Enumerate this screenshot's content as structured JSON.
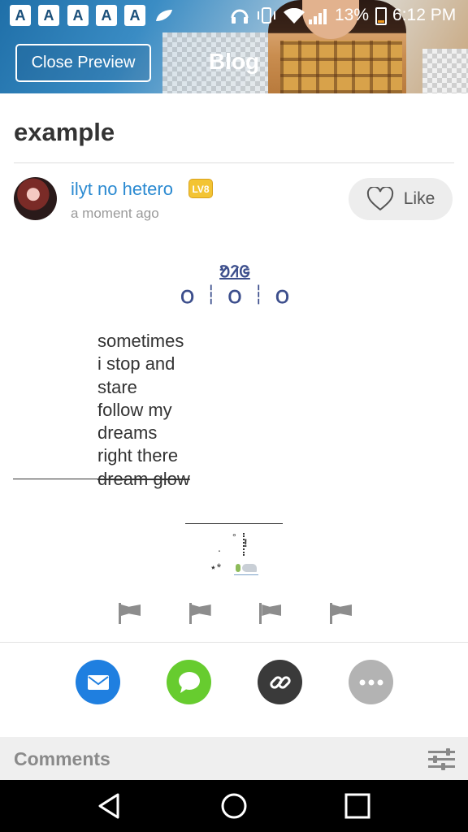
{
  "status_bar": {
    "apps": [
      "A",
      "A",
      "A",
      "A",
      "A"
    ],
    "battery": "13%",
    "time": "6:12 PM"
  },
  "header": {
    "close_label": "Close Preview",
    "title": "Blog"
  },
  "post": {
    "title": "example",
    "author": "ilyt no hetero",
    "level": "LV8",
    "time": "a moment ago",
    "like_label": "Like"
  },
  "content": {
    "deco_top": "ᱚᱤᱜ",
    "deco_row": [
      "ᱛ",
      "ᱛ",
      "ᱛ"
    ],
    "poem": [
      "sometimes",
      "i stop and",
      "stare",
      "follow my",
      "dreams",
      "right there",
      "dream glow"
    ]
  },
  "share": {
    "icons": [
      "mail-icon",
      "chat-icon",
      "link-icon",
      "more-icon"
    ],
    "colors": {
      "mail": "#1f7fe0",
      "chat": "#67cc2f",
      "link": "#3a3a3a",
      "more": "#b3b3b3"
    }
  },
  "comments": {
    "label": "Comments"
  },
  "colors": {
    "author": "#2b8ad1",
    "level_badge": "#f3c433",
    "deco": "#3c4e8c"
  }
}
